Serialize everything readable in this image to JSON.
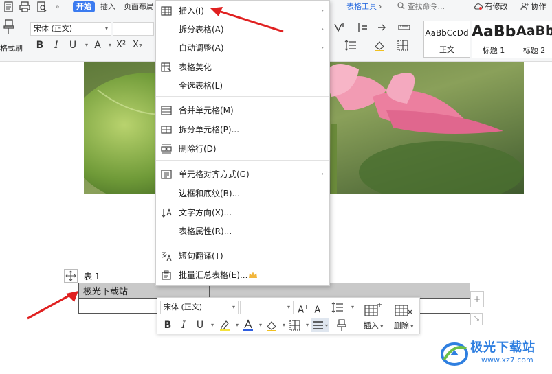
{
  "tabs": {
    "more": "»",
    "start": "开始",
    "insert": "插入",
    "page_layout": "页面布局",
    "table_tools": "表格工具",
    "search": "查找命令...",
    "modified": "有修改",
    "collab": "协作"
  },
  "ribbon": {
    "format_brush": "格式刷",
    "font_name": "宋体 (正文)",
    "bold": "B",
    "italic": "I",
    "underline": "U",
    "strike": "A",
    "superscript": "X²",
    "subscript": "X₂",
    "styles": [
      {
        "preview": "AaBbCcDd",
        "name": "正文"
      },
      {
        "preview": "AaBb",
        "name": "标题 1"
      },
      {
        "preview": "AaBb",
        "name": "标题 2"
      }
    ]
  },
  "document": {
    "caption": "表  1",
    "table_rows": [
      [
        "极光下载站",
        "",
        ""
      ],
      [
        "",
        "",
        ""
      ]
    ]
  },
  "context_menu": {
    "items": [
      {
        "label": "插入(I)",
        "icon": "table-insert-icon",
        "has_sub": true
      },
      {
        "label": "拆分表格(A)",
        "icon": "",
        "has_sub": true
      },
      {
        "label": "自动调整(A)",
        "icon": "",
        "has_sub": true
      },
      {
        "label": "表格美化",
        "icon": "table-style-icon",
        "has_sub": false
      },
      {
        "label": "全选表格(L)",
        "icon": "",
        "has_sub": false
      },
      {
        "label": "合并单元格(M)",
        "icon": "merge-cells-icon",
        "has_sub": false
      },
      {
        "label": "拆分单元格(P)...",
        "icon": "split-cells-icon",
        "has_sub": false
      },
      {
        "label": "删除行(D)",
        "icon": "delete-row-icon",
        "has_sub": false
      },
      {
        "label": "单元格对齐方式(G)",
        "icon": "cell-align-icon",
        "has_sub": true
      },
      {
        "label": "边框和底纹(B)...",
        "icon": "",
        "has_sub": false
      },
      {
        "label": "文字方向(X)...",
        "icon": "text-direction-icon",
        "has_sub": false
      },
      {
        "label": "表格属性(R)...",
        "icon": "",
        "has_sub": false
      },
      {
        "label": "短句翻译(T)",
        "icon": "translate-icon",
        "has_sub": false
      },
      {
        "label": "批量汇总表格(E)...",
        "icon": "batch-summary-icon",
        "has_sub": false
      }
    ],
    "submenu_arrow": "›"
  },
  "mini_toolbar": {
    "font_name": "宋体 (正文)",
    "font_size": "",
    "bold": "B",
    "italic": "I",
    "underline": "U",
    "insert": "插入",
    "delete": "删除"
  },
  "watermark": {
    "name": "极光下载站",
    "url": "www.xz7.com"
  },
  "colors": {
    "accent": "#3b7bf0",
    "arrow": "#e02020",
    "selection": "#c9c9c9",
    "crown": "#f2b63c"
  }
}
